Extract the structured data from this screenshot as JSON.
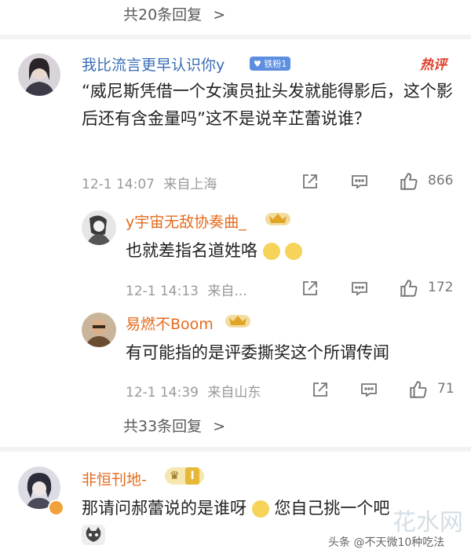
{
  "top_replies": {
    "label": "共20条回复",
    "chevron": ">"
  },
  "comment1": {
    "username": "我比流言更早认识你y",
    "fan_badge": "铁粉1",
    "hot_label": "热评",
    "text": "“威尼斯凭借一个女演员扯头发就能得影后，这个影后还有含金量吗”这不是说辛芷蕾说谁？",
    "time": "12-1 14:07",
    "location": "来自上海",
    "likes": "866"
  },
  "reply1": {
    "username": "y宇宙无敌协奏曲_",
    "text": "也就差指名道姓咯",
    "time": "12-1 14:13",
    "location": "来自...",
    "likes": "172"
  },
  "reply2": {
    "username": "易燃不Boom",
    "text": "有可能指的是评委撕奖这个所谓传闻",
    "time": "12-1 14:39",
    "location": "来自山东",
    "likes": "71"
  },
  "more_replies": {
    "label": "共33条回复",
    "chevron": ">"
  },
  "comment2": {
    "username": "非恒刊地-",
    "level_badge": "I",
    "text_before": "那请问郝蕾说的是谁呀",
    "text_after": "您自己挑一个吧"
  },
  "watermark": {
    "text": "头条 @不天微10种吃法",
    "brand": "花水网"
  },
  "colors": {
    "blue": "#3a6db5",
    "orange": "#e46b1e",
    "divider": "#f3f3f3"
  }
}
